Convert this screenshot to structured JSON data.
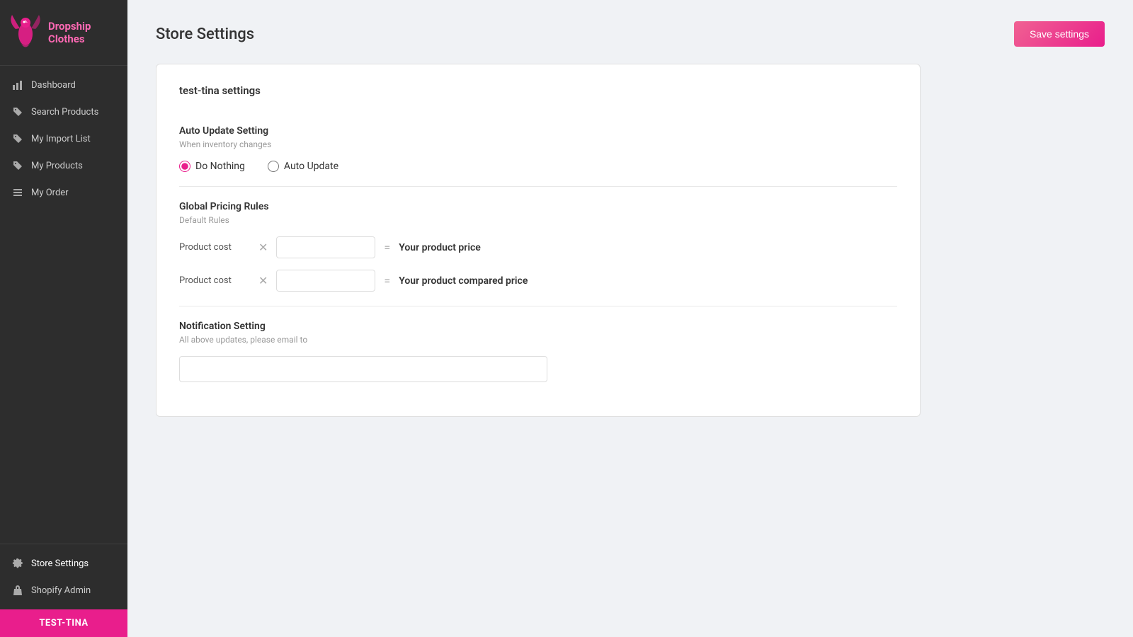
{
  "app": {
    "name": "Dropship Clothes"
  },
  "sidebar": {
    "nav_items": [
      {
        "id": "dashboard",
        "label": "Dashboard",
        "icon": "chart-bar"
      },
      {
        "id": "search-products",
        "label": "Search Products",
        "icon": "tag"
      },
      {
        "id": "my-import-list",
        "label": "My Import List",
        "icon": "tag-alt"
      },
      {
        "id": "my-products",
        "label": "My Products",
        "icon": "tag-alt2"
      },
      {
        "id": "my-order",
        "label": "My Order",
        "icon": "list"
      }
    ],
    "footer_items": [
      {
        "id": "store-settings",
        "label": "Store Settings",
        "icon": "gear",
        "active": true
      },
      {
        "id": "shopify-admin",
        "label": "Shopify Admin",
        "icon": "bag"
      }
    ],
    "user_bar": "TEST-TINA"
  },
  "header": {
    "title": "Store Settings",
    "save_button": "Save settings"
  },
  "card": {
    "title": "test-tina settings",
    "auto_update": {
      "section_title": "Auto Update Setting",
      "subtitle": "When inventory changes",
      "options": [
        {
          "id": "do-nothing",
          "label": "Do Nothing",
          "checked": true
        },
        {
          "id": "auto-update",
          "label": "Auto Update",
          "checked": false
        }
      ]
    },
    "global_pricing": {
      "section_title": "Global Pricing Rules",
      "subtitle": "Default Rules",
      "rows": [
        {
          "id": "price-row",
          "left_label": "Product cost",
          "input_value": "",
          "result_label": "Your product price"
        },
        {
          "id": "compared-price-row",
          "left_label": "Product cost",
          "input_value": "",
          "result_label": "Your product compared price"
        }
      ]
    },
    "notification": {
      "section_title": "Notification Setting",
      "subtitle": "All above updates, please email to",
      "input_value": "",
      "input_placeholder": ""
    }
  }
}
